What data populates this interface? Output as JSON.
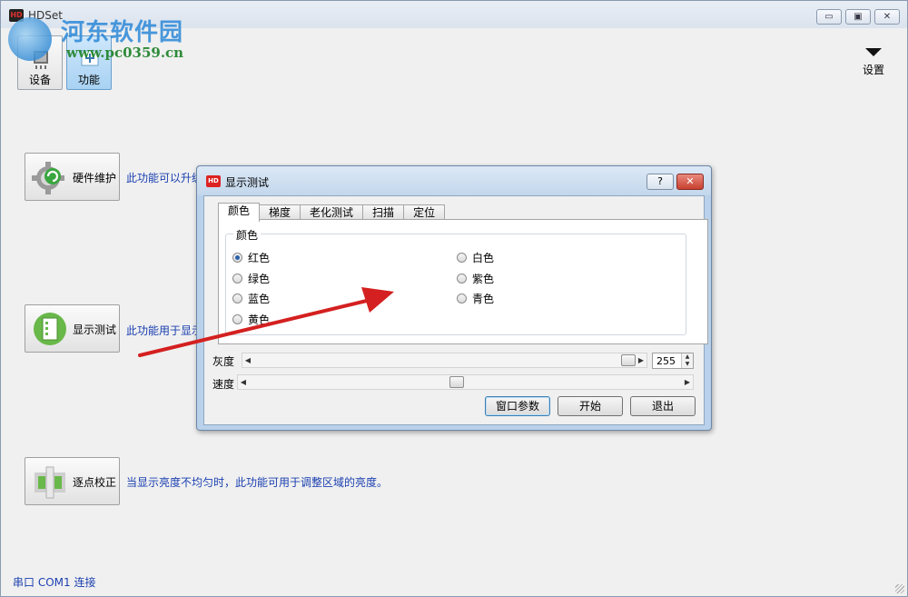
{
  "app": {
    "title": "HDSet",
    "logo_text": "HD"
  },
  "watermark": {
    "site_name": "河东软件园",
    "url": "www.pc0359.cn"
  },
  "window_controls": {
    "minimize": "▭",
    "maximize": "▣",
    "close": "✕"
  },
  "nav": {
    "tabs": [
      {
        "label": "设备",
        "icon": "device-icon",
        "active": false
      },
      {
        "label": "功能",
        "icon": "function-icon",
        "active": true
      }
    ],
    "settings_label": "设置"
  },
  "features": [
    {
      "label": "硬件维护",
      "icon": "gear-refresh-icon",
      "desc": "此功能可以升级"
    },
    {
      "label": "显示测试",
      "icon": "display-test-icon",
      "desc": "此功能用于显示"
    },
    {
      "label": "逐点校正",
      "icon": "pixel-correction-icon",
      "desc": "当显示亮度不均匀时，此功能可用于调整区域的亮度。"
    }
  ],
  "status_bar": {
    "text": "串口 COM1 连接"
  },
  "dialog": {
    "title": "显示测试",
    "logo_text": "HD",
    "help_label": "?",
    "close_label": "✕",
    "tabs": [
      "颜色",
      "梯度",
      "老化测试",
      "扫描",
      "定位"
    ],
    "active_tab": "颜色",
    "group_title": "颜色",
    "colors": [
      {
        "label": "红色",
        "selected": true
      },
      {
        "label": "绿色",
        "selected": false
      },
      {
        "label": "蓝色",
        "selected": false
      },
      {
        "label": "黄色",
        "selected": false
      },
      {
        "label": "白色",
        "selected": false
      },
      {
        "label": "紫色",
        "selected": false
      },
      {
        "label": "青色",
        "selected": false
      }
    ],
    "gray_label": "灰度",
    "gray_value": "255",
    "gray_fraction": 1.0,
    "speed_label": "速度",
    "speed_fraction": 0.48,
    "buttons": {
      "window_params": "窗口参数",
      "start": "开始",
      "exit": "退出"
    }
  },
  "colors": {
    "link_blue": "#1a3fb0",
    "annotation_red": "#d42020",
    "dialog_frame": "#b9d1ea",
    "active_tab": "#a8d2f3"
  }
}
